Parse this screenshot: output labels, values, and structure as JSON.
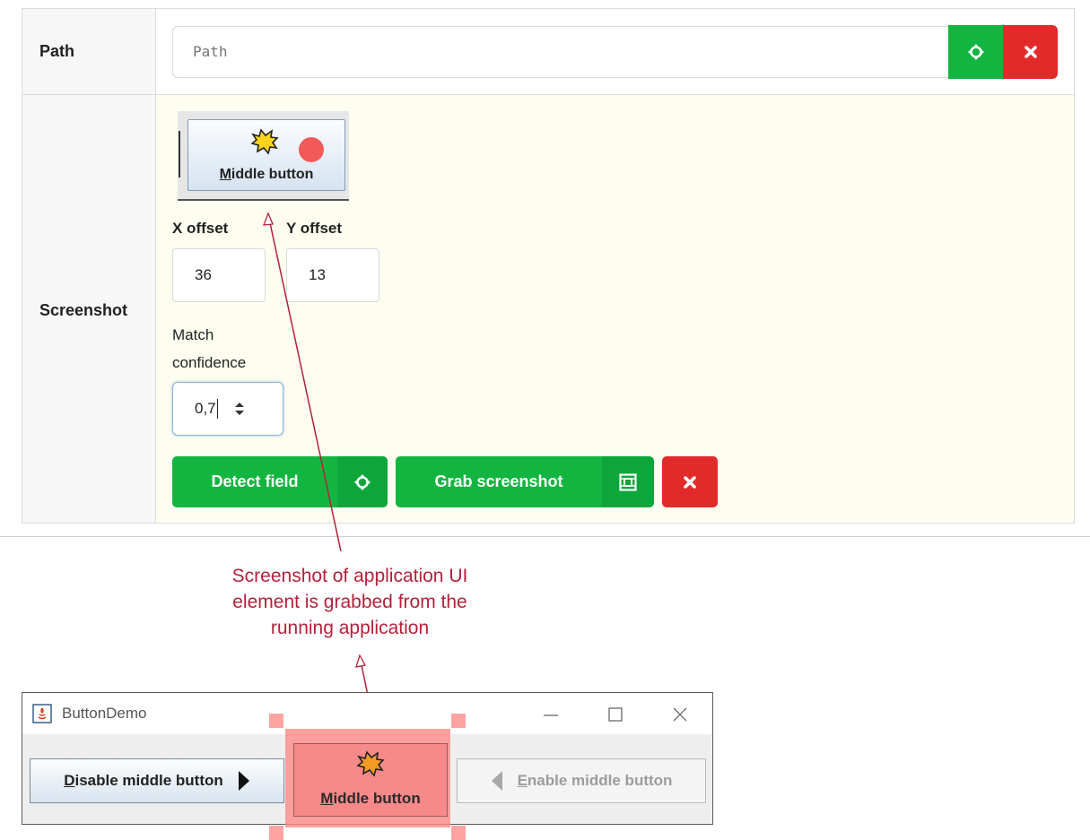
{
  "form": {
    "path_row": {
      "label": "Path",
      "input_placeholder": "Path",
      "locate_icon": "crosshair-icon",
      "clear_icon": "close-icon"
    },
    "screenshot_row": {
      "label": "Screenshot",
      "thumbnail": {
        "button_text_underline": "M",
        "button_text_rest": "iddle button",
        "icon": "starburst-icon",
        "dot_icon": "red-dot-icon"
      },
      "x_offset_label": "X offset",
      "x_offset_value": "36",
      "y_offset_label": "Y offset",
      "y_offset_value": "13",
      "match_label_line1": "Match",
      "match_label_line2": "confidence",
      "match_value": "0,7",
      "detect_button": "Detect field",
      "grab_button": "Grab screenshot",
      "grab_icon": "screenshot-frame-icon",
      "delete_icon": "close-icon"
    }
  },
  "annotation": {
    "line1": "Screenshot of application UI",
    "line2": "element is grabbed from the",
    "line3": "running application"
  },
  "java_window": {
    "title": "ButtonDemo",
    "disable_button_underline": "D",
    "disable_button_rest": "isable middle button",
    "middle_button_underline": "M",
    "middle_button_rest": "iddle button",
    "enable_button_underline": "E",
    "enable_button_rest": "nable middle button"
  },
  "colors": {
    "green": "#12b53f",
    "red": "#e12a2a",
    "annotation": "#b5213a",
    "highlight": "#ff8a8a"
  }
}
